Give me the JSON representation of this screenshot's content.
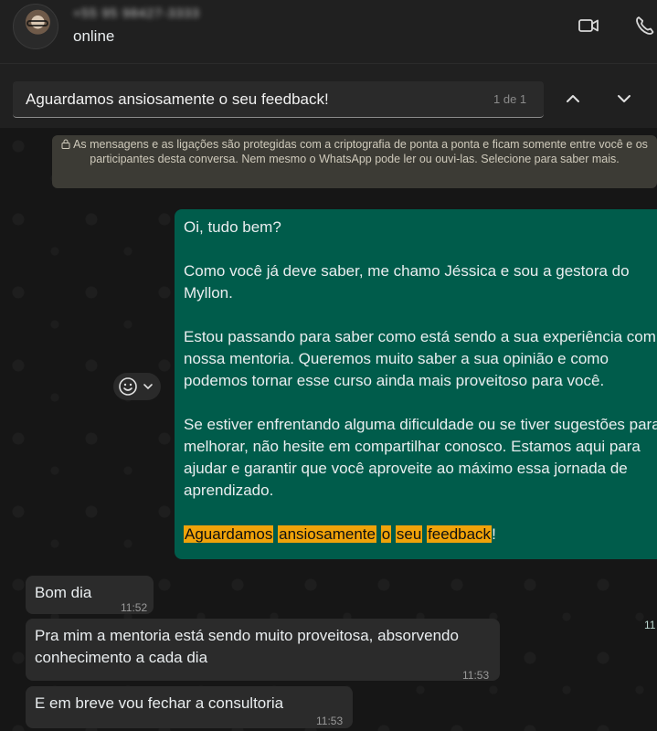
{
  "header": {
    "contact_phone": "+55 95 98427-3333",
    "status": "online",
    "video_call_icon": "video-camera-icon",
    "voice_call_icon": "phone-icon"
  },
  "search": {
    "value": "Aguardamos ansiosamente o seu feedback!",
    "count": "1 de 1",
    "prev_icon": "chevron-up-icon",
    "next_icon": "chevron-down-icon"
  },
  "system_note": {
    "text": "As mensagens e as ligações são protegidas com a criptografia de ponta a ponta e ficam somente entre você e os participantes desta conversa. Nem mesmo o WhatsApp pode ler ou ouvi-las. Selecione para saber mais."
  },
  "outgoing": {
    "p1": "Oi, tudo bem?",
    "p2a": "Como você já deve saber, me chamo Jéssica e sou a gestora do",
    "p2b": "Myllon.",
    "p3a": "Estou passando para saber como está sendo a sua experiência com",
    "p3b": "nossa mentoria. Queremos muito saber a sua opinião e como",
    "p3c": "podemos tornar esse curso ainda mais proveitoso para você.",
    "p4a": "Se estiver enfrentando alguma dificuldade ou se tiver sugestões para",
    "p4b": "melhorar, não hesite em compartilhar conosco. Estamos aqui para",
    "p4c": "ajudar e garantir que você aproveite ao máximo essa jornada de",
    "p4d": "aprendizado.",
    "hl_words": [
      "Aguardamos",
      "ansiosamente",
      "o",
      "seu",
      "feedback"
    ],
    "hl_end": "!",
    "time": "11"
  },
  "incoming": [
    {
      "text": "Bom dia",
      "time": "11:52"
    },
    {
      "text_a": "Pra mim a mentoria está sendo muito proveitosa, absorvendo",
      "text_b": "conhecimento a cada dia",
      "time": "11:53"
    },
    {
      "text": "E em breve vou fechar a consultoria",
      "time": "11:53"
    }
  ],
  "colors": {
    "outgoing_bubble": "#005c4b",
    "incoming_bubble": "#2b2b2b",
    "highlight": "#f0a30a",
    "system_note": "#3c3b35"
  }
}
